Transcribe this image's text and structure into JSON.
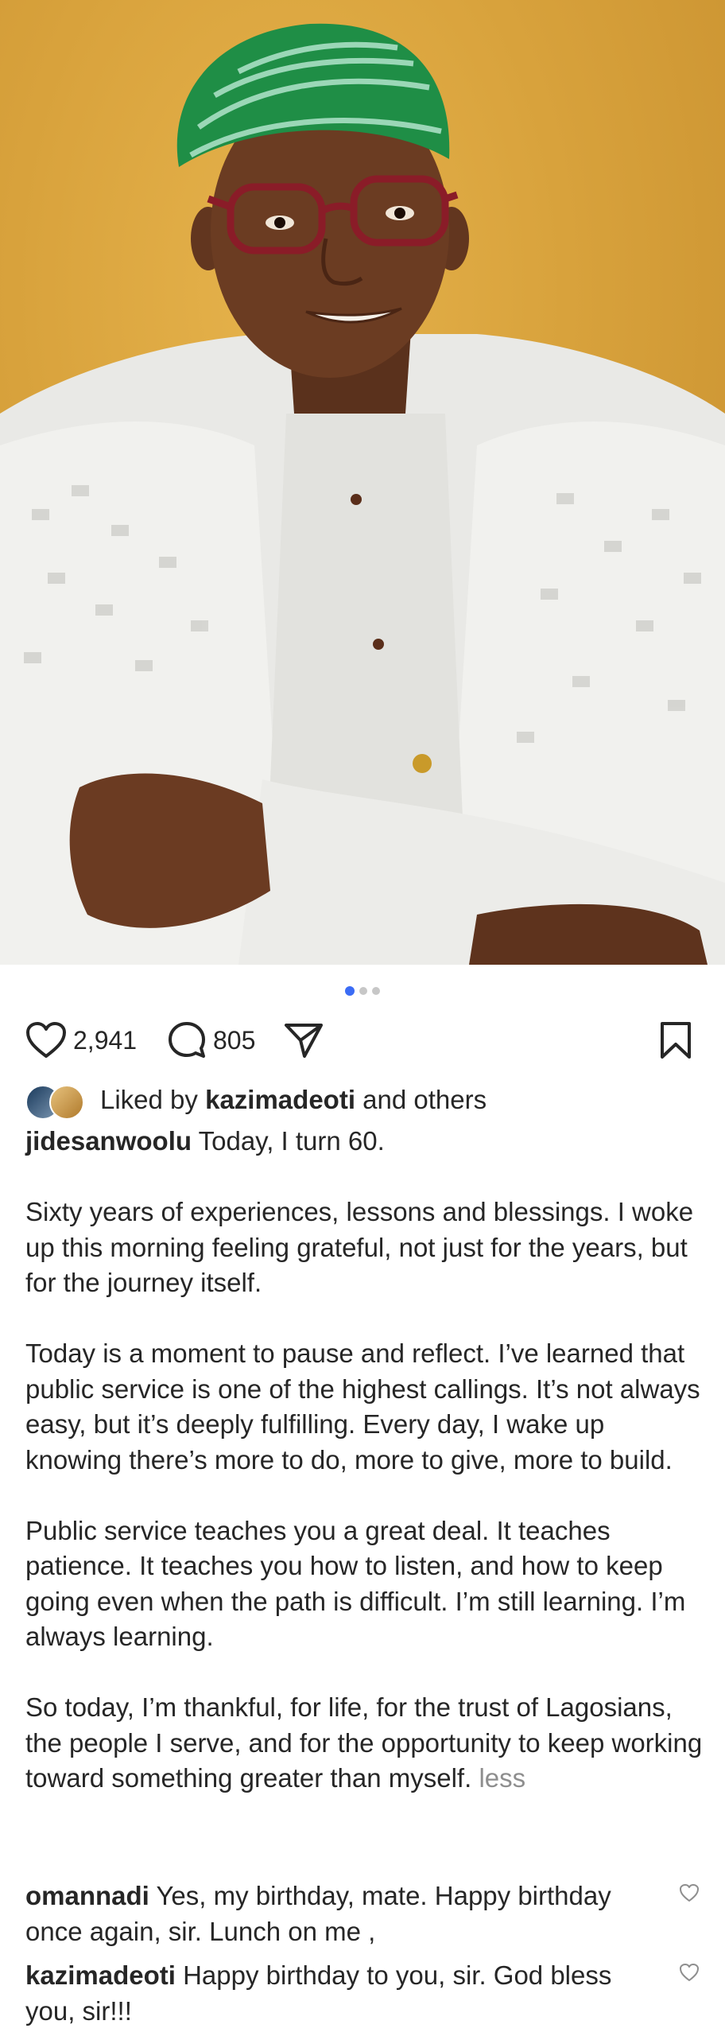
{
  "post": {
    "carousel": {
      "count": 3,
      "active_index": 0
    },
    "likes_count": "2,941",
    "comments_count": "805",
    "liked_by": {
      "prefix": "Liked by",
      "user": "kazimadeoti",
      "suffix": "and others"
    },
    "caption": {
      "username": "jidesanwoolu",
      "first_line": "Today, I turn 60.",
      "paragraphs": [
        "Sixty years of experiences, lessons and blessings. I woke up this morning feeling grateful, not just for the years, but for the journey itself.",
        "Today is a moment to pause and reflect. I’ve learned that public service is one of the highest callings. It’s not always easy, but it’s deeply fulfilling. Every day, I wake up knowing there’s more to do, more to give, more to build.",
        "Public service teaches you a great deal. It teaches patience. It teaches you how to listen, and how to keep going even when the path is difficult. I’m still learning. I’m always learning.",
        "So today, I’m thankful, for life, for the trust of Lagosians, the people I serve, and for the opportunity to keep working toward something greater than myself."
      ],
      "less_label": "less"
    },
    "comments": [
      {
        "user": "omannadi",
        "text": "Yes, my birthday, mate. Happy birthday once again, sir. Lunch on me ,"
      },
      {
        "user": "kazimadeoti",
        "text": "Happy birthday to you, sir. God bless you, sir!!!"
      }
    ]
  },
  "icons": {
    "like": "heart-icon",
    "comment": "comment-bubble-icon",
    "share": "paper-plane-icon",
    "save": "bookmark-icon"
  },
  "colors": {
    "text": "#262626",
    "muted": "#8e8e8e",
    "dot_active": "#3b6cf5",
    "dot_inactive": "#c7c7c7",
    "photo_background": "#d8a23c"
  }
}
